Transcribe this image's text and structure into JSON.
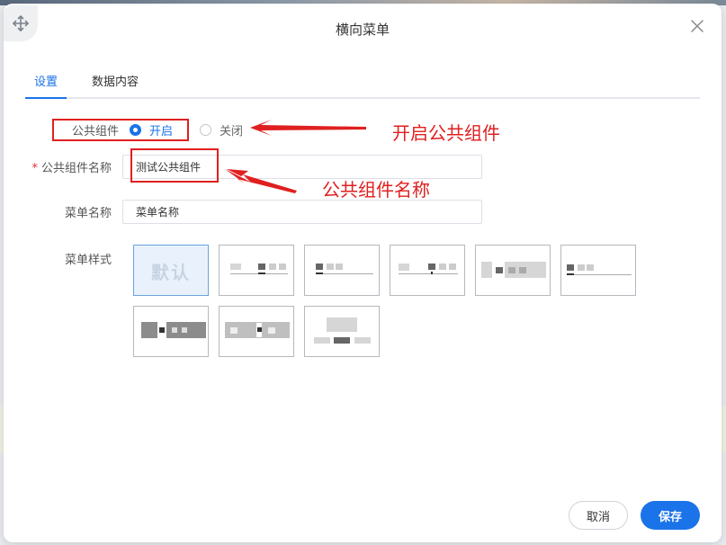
{
  "dialog": {
    "title": "横向菜单"
  },
  "tabs": [
    {
      "label": "设置",
      "active": true
    },
    {
      "label": "数据内容",
      "active": false
    }
  ],
  "form": {
    "public_component": {
      "label": "公共组件",
      "options": [
        {
          "label": "开启",
          "checked": true
        },
        {
          "label": "关闭",
          "checked": false
        }
      ]
    },
    "public_name": {
      "label": "公共组件名称",
      "required_mark": "*",
      "value": "测试公共组件"
    },
    "menu_name": {
      "label": "菜单名称",
      "value": "菜单名称"
    },
    "menu_style": {
      "label": "菜单样式",
      "default_option_text": "默认",
      "selected_index": 0,
      "option_count": 9
    }
  },
  "annotations": {
    "enable_public": "开启公共组件",
    "public_name": "公共组件名称",
    "color": "#e02020"
  },
  "footer": {
    "cancel_label": "取消",
    "save_label": "保存"
  },
  "colors": {
    "accent": "#1a73e8",
    "annotation": "#e02020",
    "selected_style_bg": "#e9f2fc"
  },
  "icons": {
    "move": "move-arrows-icon",
    "close": "close-icon"
  }
}
